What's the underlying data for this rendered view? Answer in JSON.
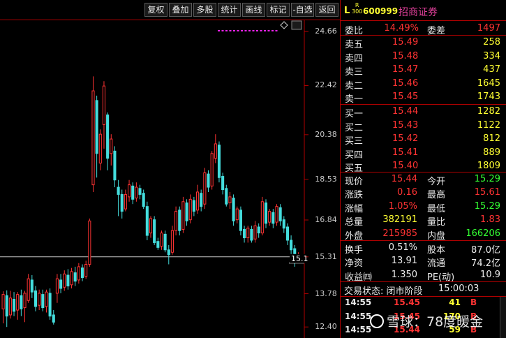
{
  "toolbar": {
    "buttons": [
      {
        "label": "复权",
        "name": "restore-rights-button"
      },
      {
        "label": "叠加",
        "name": "overlay-button"
      },
      {
        "label": "多股",
        "name": "multi-stock-button"
      },
      {
        "label": "统计",
        "name": "statistics-button"
      },
      {
        "label": "画线",
        "name": "draw-line-button"
      },
      {
        "label": "标记",
        "name": "mark-button"
      },
      {
        "label": "-自选",
        "name": "remove-watchlist-button"
      },
      {
        "label": "返回",
        "name": "back-button"
      }
    ]
  },
  "chart_data": {
    "type": "candlestick",
    "y_ticks": [
      "24.66",
      "22.42",
      "20.38",
      "18.53",
      "16.84",
      "15.31",
      "13.78",
      "12.40"
    ],
    "ylim": [
      12.0,
      25.1
    ],
    "last_price_label": "15.1",
    "reference_price": 15.31,
    "colors": {
      "up": "#ff3333",
      "down": "#44dddd",
      "marker": "#ff22ff"
    },
    "candles": [
      {
        "o": 13.15,
        "c": 13.75,
        "h": 13.88,
        "l": 12.55
      },
      {
        "o": 13.7,
        "c": 12.85,
        "h": 13.92,
        "l": 12.4
      },
      {
        "o": 12.9,
        "c": 13.6,
        "h": 13.9,
        "l": 12.75
      },
      {
        "o": 13.55,
        "c": 13.05,
        "h": 13.85,
        "l": 12.85
      },
      {
        "o": 13.1,
        "c": 13.75,
        "h": 13.85,
        "l": 12.7
      },
      {
        "o": 13.7,
        "c": 13.15,
        "h": 13.95,
        "l": 12.85
      },
      {
        "o": 13.2,
        "c": 13.8,
        "h": 13.9,
        "l": 12.6
      },
      {
        "o": 13.5,
        "c": 14.4,
        "h": 14.6,
        "l": 13.4
      },
      {
        "o": 14.35,
        "c": 13.85,
        "h": 14.55,
        "l": 13.6
      },
      {
        "o": 13.9,
        "c": 13.25,
        "h": 14.1,
        "l": 13.05
      },
      {
        "o": 13.3,
        "c": 13.8,
        "h": 13.95,
        "l": 13.1
      },
      {
        "o": 13.75,
        "c": 13.2,
        "h": 13.95,
        "l": 13.05
      },
      {
        "o": 13.25,
        "c": 13.85,
        "h": 13.95,
        "l": 13.0
      },
      {
        "o": 13.8,
        "c": 12.85,
        "h": 14.0,
        "l": 12.7
      },
      {
        "o": 12.9,
        "c": 12.6,
        "h": 13.1,
        "l": 12.5
      },
      {
        "o": 13.8,
        "c": 14.4,
        "h": 14.6,
        "l": 13.4
      },
      {
        "o": 14.35,
        "c": 14.0,
        "h": 14.6,
        "l": 13.8
      },
      {
        "o": 14.05,
        "c": 14.6,
        "h": 14.75,
        "l": 13.9
      },
      {
        "o": 14.55,
        "c": 14.1,
        "h": 14.8,
        "l": 13.95
      },
      {
        "o": 14.15,
        "c": 14.7,
        "h": 14.85,
        "l": 14.0
      },
      {
        "o": 14.65,
        "c": 14.3,
        "h": 14.9,
        "l": 14.1
      },
      {
        "o": 14.35,
        "c": 14.9,
        "h": 15.05,
        "l": 14.2
      },
      {
        "o": 14.85,
        "c": 14.45,
        "h": 15.0,
        "l": 14.3
      },
      {
        "o": 14.5,
        "c": 15.0,
        "h": 15.15,
        "l": 14.4
      },
      {
        "o": 15.0,
        "c": 16.8,
        "h": 16.9,
        "l": 14.9
      },
      {
        "o": 18.3,
        "c": 22.2,
        "h": 22.8,
        "l": 18.0
      },
      {
        "o": 21.8,
        "c": 19.6,
        "h": 22.0,
        "l": 18.6
      },
      {
        "o": 19.2,
        "c": 20.4,
        "h": 20.6,
        "l": 18.9
      },
      {
        "o": 20.8,
        "c": 22.4,
        "h": 22.6,
        "l": 19.8
      },
      {
        "o": 21.2,
        "c": 19.4,
        "h": 21.3,
        "l": 18.9
      },
      {
        "o": 19.6,
        "c": 20.2,
        "h": 20.4,
        "l": 19.1
      },
      {
        "o": 19.7,
        "c": 18.5,
        "h": 19.9,
        "l": 18.2
      },
      {
        "o": 18.2,
        "c": 17.9,
        "h": 18.5,
        "l": 17.0
      },
      {
        "o": 17.9,
        "c": 17.2,
        "h": 18.1,
        "l": 16.9
      },
      {
        "o": 17.3,
        "c": 17.9,
        "h": 18.1,
        "l": 17.2
      },
      {
        "o": 17.8,
        "c": 18.3,
        "h": 18.5,
        "l": 17.6
      },
      {
        "o": 18.25,
        "c": 17.7,
        "h": 18.4,
        "l": 17.5
      },
      {
        "o": 17.75,
        "c": 18.2,
        "h": 18.4,
        "l": 17.6
      },
      {
        "o": 18.15,
        "c": 17.9,
        "h": 18.3,
        "l": 17.7
      },
      {
        "o": 17.95,
        "c": 17.4,
        "h": 18.1,
        "l": 17.3
      },
      {
        "o": 17.4,
        "c": 16.2,
        "h": 17.6,
        "l": 16.0
      },
      {
        "o": 16.3,
        "c": 16.9,
        "h": 17.0,
        "l": 16.1
      },
      {
        "o": 16.85,
        "c": 15.9,
        "h": 17.0,
        "l": 15.8
      },
      {
        "o": 15.95,
        "c": 15.7,
        "h": 16.1,
        "l": 15.6
      },
      {
        "o": 15.75,
        "c": 16.3,
        "h": 16.4,
        "l": 15.6
      },
      {
        "o": 16.25,
        "c": 15.6,
        "h": 16.4,
        "l": 15.5
      },
      {
        "o": 15.6,
        "c": 15.4,
        "h": 15.8,
        "l": 15.0
      },
      {
        "o": 15.5,
        "c": 16.4,
        "h": 16.6,
        "l": 15.4
      },
      {
        "o": 16.4,
        "c": 17.2,
        "h": 17.4,
        "l": 16.2
      },
      {
        "o": 17.25,
        "c": 16.4,
        "h": 17.4,
        "l": 16.2
      },
      {
        "o": 16.45,
        "c": 17.6,
        "h": 17.8,
        "l": 16.3
      },
      {
        "o": 17.55,
        "c": 16.8,
        "h": 17.7,
        "l": 16.6
      },
      {
        "o": 16.85,
        "c": 17.7,
        "h": 17.9,
        "l": 16.7
      },
      {
        "o": 17.65,
        "c": 17.2,
        "h": 17.8,
        "l": 17.0
      },
      {
        "o": 17.25,
        "c": 18.0,
        "h": 18.3,
        "l": 17.1
      },
      {
        "o": 17.95,
        "c": 17.4,
        "h": 18.1,
        "l": 17.2
      },
      {
        "o": 17.5,
        "c": 18.8,
        "h": 19.0,
        "l": 17.3
      },
      {
        "o": 18.75,
        "c": 18.2,
        "h": 18.9,
        "l": 18.0
      },
      {
        "o": 18.25,
        "c": 19.6,
        "h": 19.7,
        "l": 18.1
      },
      {
        "o": 19.4,
        "c": 20.0,
        "h": 20.4,
        "l": 19.2
      },
      {
        "o": 19.95,
        "c": 18.6,
        "h": 20.1,
        "l": 18.4
      },
      {
        "o": 18.65,
        "c": 18.1,
        "h": 18.8,
        "l": 17.9
      },
      {
        "o": 18.15,
        "c": 17.5,
        "h": 18.3,
        "l": 17.4
      },
      {
        "o": 17.55,
        "c": 17.8,
        "h": 18.0,
        "l": 17.3
      },
      {
        "o": 17.75,
        "c": 16.8,
        "h": 17.9,
        "l": 16.6
      },
      {
        "o": 16.85,
        "c": 17.3,
        "h": 17.4,
        "l": 16.7
      },
      {
        "o": 17.25,
        "c": 16.4,
        "h": 17.4,
        "l": 16.2
      },
      {
        "o": 16.45,
        "c": 16.1,
        "h": 16.6,
        "l": 15.9
      },
      {
        "o": 16.1,
        "c": 16.5,
        "h": 16.6,
        "l": 15.9
      },
      {
        "o": 16.45,
        "c": 16.0,
        "h": 16.6,
        "l": 15.9
      },
      {
        "o": 16.05,
        "c": 16.6,
        "h": 16.8,
        "l": 15.9
      },
      {
        "o": 16.55,
        "c": 16.3,
        "h": 16.7,
        "l": 16.1
      },
      {
        "o": 16.3,
        "c": 17.6,
        "h": 17.8,
        "l": 16.2
      },
      {
        "o": 17.55,
        "c": 16.7,
        "h": 17.7,
        "l": 16.5
      },
      {
        "o": 16.75,
        "c": 17.2,
        "h": 17.3,
        "l": 16.6
      },
      {
        "o": 17.15,
        "c": 16.7,
        "h": 17.3,
        "l": 16.5
      },
      {
        "o": 16.75,
        "c": 17.4,
        "h": 17.5,
        "l": 16.6
      },
      {
        "o": 17.35,
        "c": 16.8,
        "h": 17.5,
        "l": 16.6
      },
      {
        "o": 16.85,
        "c": 16.5,
        "h": 17.0,
        "l": 16.3
      },
      {
        "o": 16.55,
        "c": 16.0,
        "h": 16.7,
        "l": 15.8
      },
      {
        "o": 16.0,
        "c": 15.6,
        "h": 16.2,
        "l": 15.4
      },
      {
        "o": 15.65,
        "c": 15.2,
        "h": 15.8,
        "l": 14.9
      },
      {
        "o": 15.25,
        "c": 15.4,
        "h": 15.5,
        "l": 15.1
      }
    ]
  },
  "panel": {
    "header": {
      "letter": "L",
      "r_line1": "R",
      "r_line2": "300",
      "code": "600999",
      "name": "招商证券"
    },
    "weibi": {
      "label": "委比",
      "value": "14.49%",
      "label2": "委差",
      "value2": "1497"
    },
    "sells": [
      {
        "label": "卖五",
        "price": "15.49",
        "vol": "258"
      },
      {
        "label": "卖四",
        "price": "15.48",
        "vol": "334"
      },
      {
        "label": "卖三",
        "price": "15.47",
        "vol": "437"
      },
      {
        "label": "卖二",
        "price": "15.46",
        "vol": "1645"
      },
      {
        "label": "卖一",
        "price": "15.45",
        "vol": "1743"
      }
    ],
    "buys": [
      {
        "label": "买一",
        "price": "15.44",
        "vol": "1282"
      },
      {
        "label": "买二",
        "price": "15.43",
        "vol": "1122"
      },
      {
        "label": "买三",
        "price": "15.42",
        "vol": "812"
      },
      {
        "label": "买四",
        "price": "15.41",
        "vol": "889"
      },
      {
        "label": "买五",
        "price": "15.40",
        "vol": "1809"
      }
    ],
    "stats": [
      {
        "l1": "现价",
        "v1": "15.44",
        "c1": "red",
        "l2": "今开",
        "v2": "15.29",
        "c2": "grn"
      },
      {
        "l1": "涨跌",
        "v1": "0.16",
        "c1": "red",
        "l2": "最高",
        "v2": "15.61",
        "c2": "red"
      },
      {
        "l1": "涨幅",
        "v1": "1.05%",
        "c1": "red",
        "l2": "最低",
        "v2": "15.29",
        "c2": "grn"
      },
      {
        "l1": "总量",
        "v1": "382191",
        "c1": "yel",
        "l2": "量比",
        "v2": "1.83",
        "c2": "red"
      },
      {
        "l1": "外盘",
        "v1": "215985",
        "c1": "red",
        "l2": "内盘",
        "v2": "166206",
        "c2": "grn"
      }
    ],
    "fin": [
      {
        "l1": "换手",
        "v1": "0.51%",
        "l2": "股本",
        "v2": "87.0亿"
      },
      {
        "l1": "净资",
        "v1": "13.91",
        "l2": "流通",
        "v2": "74.2亿"
      },
      {
        "l1": "收益㈣",
        "v1": "1.350",
        "l2": "PE(动)",
        "v2": "10.9"
      }
    ],
    "status": {
      "label": "交易状态: 闭市阶段",
      "time": "15:00:03"
    },
    "trades": [
      {
        "time": "14:55",
        "price": "15.45",
        "vol": "41",
        "side": "B"
      },
      {
        "time": "14:55",
        "price": "15.45",
        "vol": "170",
        "side": "B"
      },
      {
        "time": "14:55",
        "price": "15.44",
        "vol": "59",
        "side": "B"
      }
    ]
  },
  "watermark": {
    "text": "雪球：78度暖金"
  }
}
